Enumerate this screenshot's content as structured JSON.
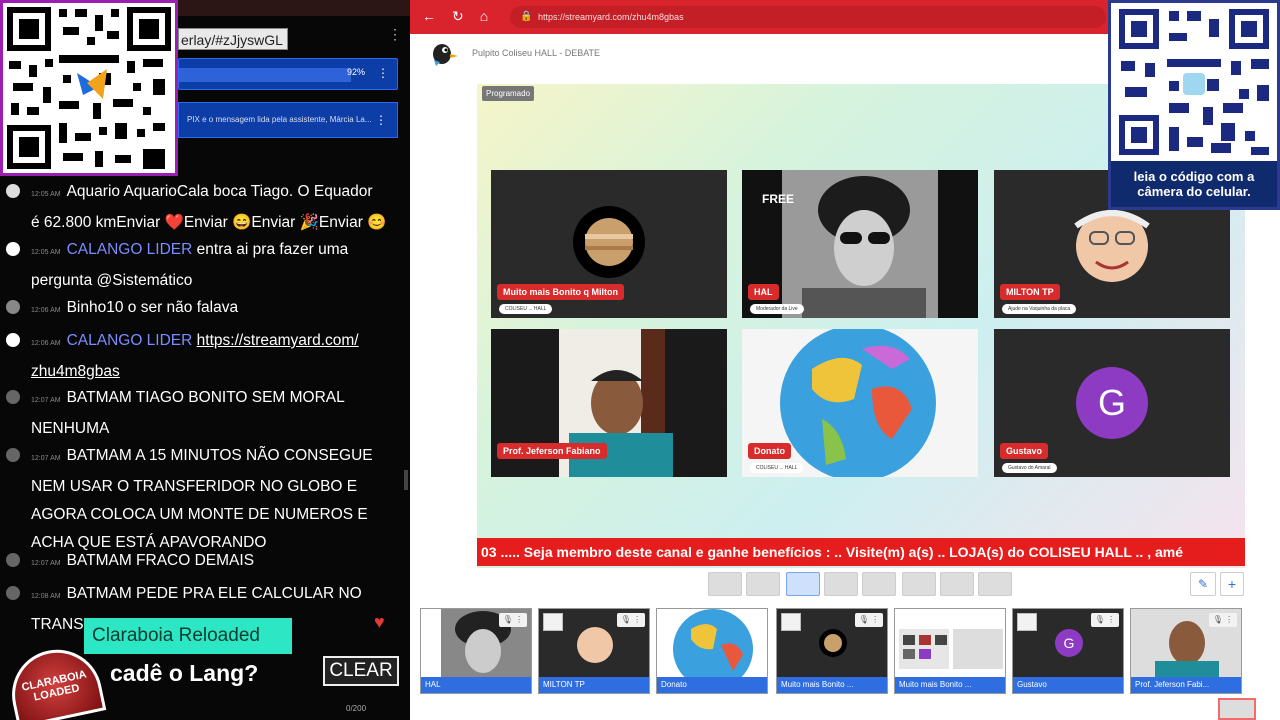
{
  "chat": {
    "topbar_text": "",
    "url_fragment": "erlay/#zJjyswGL",
    "progress": {
      "percent_label": "92%",
      "percent": 92
    },
    "pix_note": "PIX e o mensagem lida pela assistente, Márcia La...",
    "messages": [
      {
        "time": "12:05 AM",
        "author": "Aquario",
        "text_lines": [
          "AquarioCala boca Tiago. O Equador",
          "é 62.800 kmEnviar ❤️Enviar 😄Enviar 🎉Enviar 😊"
        ]
      },
      {
        "time": "12:05 AM",
        "author": "CALANGO LIDER",
        "text_lines": [
          "entra ai pra fazer uma",
          "pergunta @Sistemático"
        ]
      },
      {
        "time": "12:06 AM",
        "author": "Binho10",
        "text_lines": [
          "o ser não falava"
        ]
      },
      {
        "time": "12:06 AM",
        "author": "CALANGO LIDER",
        "link_lines": [
          "https://streamyard.com/",
          "zhu4m8gbas"
        ]
      },
      {
        "time": "12:07 AM",
        "author": "BATMAM",
        "text_lines": [
          "TIAGO BONITO SEM MORAL",
          "NENHUMA"
        ]
      },
      {
        "time": "12:07 AM",
        "author": "BATMAM",
        "text_lines": [
          "A 15 MINUTOS NÃO CONSEGUE",
          "NEM USAR O TRANSFERIDOR NO GLOBO E",
          "AGORA COLOCA UM MONTE DE NUMEROS E",
          "ACHA QUE ESTÁ APAVORANDO"
        ]
      },
      {
        "time": "12:07 AM",
        "author": "BATMAM",
        "text_lines": [
          "FRACO DEMAIS"
        ]
      },
      {
        "time": "12:08 AM",
        "author": "BATMAM",
        "text_lines": [
          "PEDE PRA ELE CALCULAR NO",
          "TRANS"
        ]
      }
    ],
    "brand": "Claraboia Reloaded",
    "logo_text": "CLARABOIA LOADED",
    "message": "cadê o Lang?",
    "clear_label": "CLEAR",
    "counter": "0/200"
  },
  "browser": {
    "address": "https://streamyard.com/zhu4m8gbas",
    "studio_title": "Pulpito Coliseu HALL - DEBATE",
    "badge": "Programado",
    "qr_caption_1": "leia o código com a",
    "qr_caption_2": "câmera do celular.",
    "ticker": "03 ..... Seja membro deste canal e ganhe benefícios : .. Visite(m) a(s) .. LOJA(s) do COLISEU HALL .. , amé",
    "tiles": [
      {
        "name": "Muito mais Bonito q Milton",
        "sub": "COLISEU ... HALL"
      },
      {
        "name": "HAL",
        "sub": "Moderador da Live",
        "overlay": "FREE"
      },
      {
        "name": "MILTON TP",
        "sub": "Ajude na Vaquinha da placa"
      },
      {
        "name": "Prof. Jeferson Fabiano",
        "sub": ""
      },
      {
        "name": "Donato",
        "sub": "COLISEU ... HALL"
      },
      {
        "name": "Gustavo",
        "sub": "Gustavo do Amaral",
        "initial": "G"
      }
    ],
    "thumbs": [
      "HAL",
      "MILTON TP",
      "Donato",
      "Muito mais Bonito ...",
      "Muito mais Bonito ...",
      "Gustavo",
      "Prof. Jeferson Fabi..."
    ],
    "thumb_initial": "G",
    "colors": {
      "accent": "#d9232d",
      "thumb_blue": "#2f6ee0",
      "chat_author": "#7b8cff",
      "teal": "#2ce6c4"
    }
  }
}
